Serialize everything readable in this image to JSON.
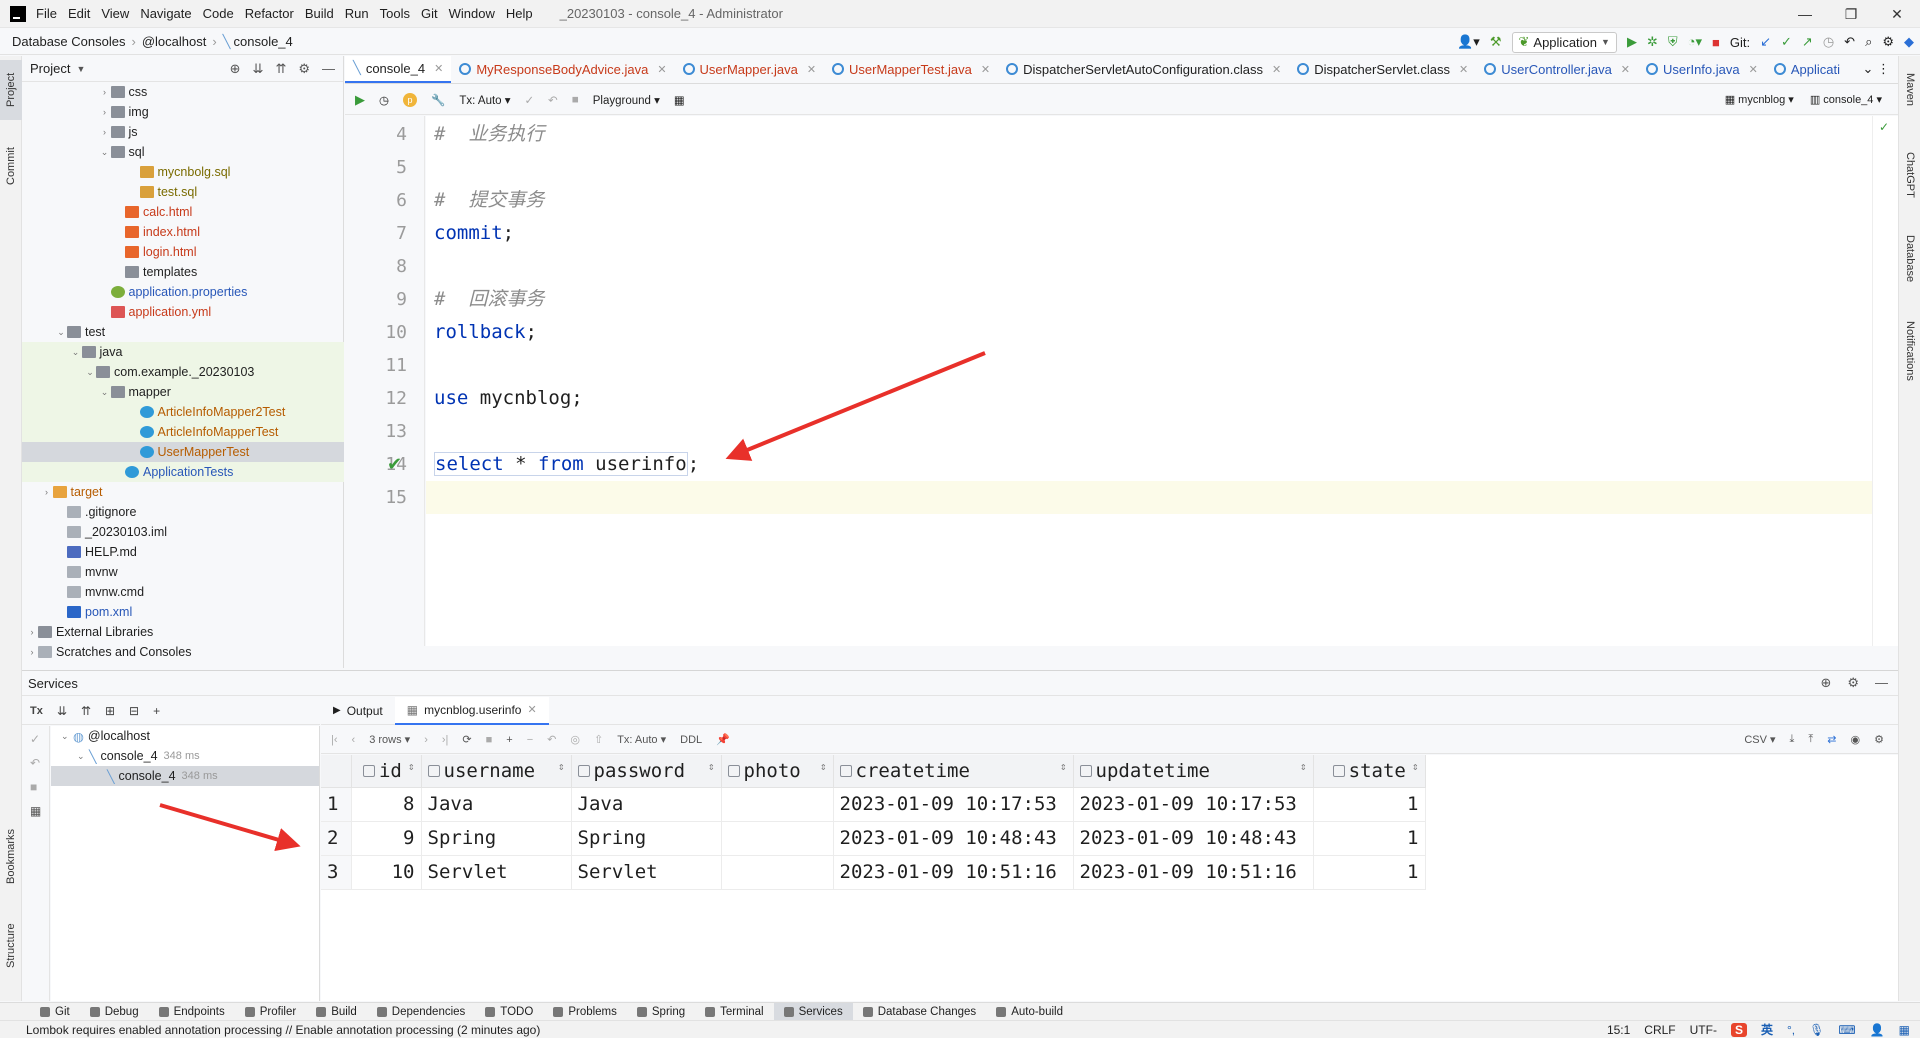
{
  "titlebar": {
    "menu": [
      "File",
      "Edit",
      "View",
      "Navigate",
      "Code",
      "Refactor",
      "Build",
      "Run",
      "Tools",
      "Git",
      "Window",
      "Help"
    ],
    "title": "_20230103 - console_4 - Administrator"
  },
  "navbar": {
    "crumbs": [
      "Database Consoles",
      "@localhost",
      "console_4"
    ],
    "run_config": "Application",
    "git_label": "Git:"
  },
  "left_stripe": {
    "project": "Project",
    "commit": "Commit",
    "bookmarks": "Bookmarks",
    "structure": "Structure"
  },
  "right_stripe": {
    "maven": "Maven",
    "chatgpt": "ChatGPT",
    "database": "Database",
    "notifications": "Notifications"
  },
  "project": {
    "title": "Project",
    "tree": [
      {
        "label": "css",
        "depth": 5,
        "icon": "folder",
        "arrow": "›"
      },
      {
        "label": "img",
        "depth": 5,
        "icon": "folder",
        "arrow": "›"
      },
      {
        "label": "js",
        "depth": 5,
        "icon": "folder",
        "arrow": "›"
      },
      {
        "label": "sql",
        "depth": 5,
        "icon": "folder",
        "arrow": "⌄"
      },
      {
        "label": "mycnbolg.sql",
        "depth": 7,
        "icon": "sql",
        "color": "olive"
      },
      {
        "label": "test.sql",
        "depth": 7,
        "icon": "sql",
        "color": "olive"
      },
      {
        "label": "calc.html",
        "depth": 6,
        "icon": "html",
        "color": "red"
      },
      {
        "label": "index.html",
        "depth": 6,
        "icon": "html",
        "color": "red"
      },
      {
        "label": "login.html",
        "depth": 6,
        "icon": "html",
        "color": "red"
      },
      {
        "label": "templates",
        "depth": 6,
        "icon": "folder"
      },
      {
        "label": "application.properties",
        "depth": 5,
        "icon": "prop",
        "color": "blue"
      },
      {
        "label": "application.yml",
        "depth": 5,
        "icon": "yml",
        "color": "red"
      },
      {
        "label": "test",
        "depth": 2,
        "icon": "folder",
        "arrow": "⌄"
      },
      {
        "label": "java",
        "depth": 3,
        "icon": "folder-green",
        "arrow": "⌄",
        "hl": "green"
      },
      {
        "label": "com.example._20230103",
        "depth": 4,
        "icon": "folder",
        "arrow": "⌄",
        "hl": "green"
      },
      {
        "label": "mapper",
        "depth": 5,
        "icon": "folder",
        "arrow": "⌄",
        "hl": "green"
      },
      {
        "label": "ArticleInfoMapper2Test",
        "depth": 7,
        "icon": "java",
        "color": "orange",
        "hl": "green"
      },
      {
        "label": "ArticleInfoMapperTest",
        "depth": 7,
        "icon": "java",
        "color": "orange",
        "hl": "green"
      },
      {
        "label": "UserMapperTest",
        "depth": 7,
        "icon": "java",
        "color": "orange",
        "hl": "sel"
      },
      {
        "label": "ApplicationTests",
        "depth": 6,
        "icon": "java",
        "color": "blue",
        "hl": "green"
      },
      {
        "label": "target",
        "depth": 1,
        "icon": "folder-orange",
        "arrow": "›",
        "color": "orange"
      },
      {
        "label": ".gitignore",
        "depth": 2,
        "icon": "gen"
      },
      {
        "label": "_20230103.iml",
        "depth": 2,
        "icon": "gen"
      },
      {
        "label": "HELP.md",
        "depth": 2,
        "icon": "md"
      },
      {
        "label": "mvnw",
        "depth": 2,
        "icon": "gen"
      },
      {
        "label": "mvnw.cmd",
        "depth": 2,
        "icon": "gen"
      },
      {
        "label": "pom.xml",
        "depth": 2,
        "icon": "xml",
        "color": "blue"
      },
      {
        "label": "External Libraries",
        "depth": 0,
        "icon": "lib",
        "arrow": "›"
      },
      {
        "label": "Scratches and Consoles",
        "depth": 0,
        "icon": "gen",
        "arrow": "›"
      }
    ]
  },
  "editor": {
    "tabs": [
      {
        "label": "console_4",
        "active": true,
        "color": "#1f1f1f"
      },
      {
        "label": "MyResponseBodyAdvice.java",
        "color": "#c73a1a"
      },
      {
        "label": "UserMapper.java",
        "color": "#c73a1a"
      },
      {
        "label": "UserMapperTest.java",
        "color": "#c73a1a"
      },
      {
        "label": "DispatcherServletAutoConfiguration.class",
        "color": "#1f1f1f"
      },
      {
        "label": "DispatcherServlet.class",
        "color": "#1f1f1f"
      },
      {
        "label": "UserController.java",
        "color": "#2857b8"
      },
      {
        "label": "UserInfo.java",
        "color": "#2857b8"
      },
      {
        "label": "Applicati",
        "color": "#2857b8"
      }
    ],
    "toolbar": {
      "tx": "Tx: Auto",
      "playground": "Playground",
      "schema": "mycnblog",
      "console": "console_4"
    },
    "lines": [
      {
        "n": "4",
        "html": "<span class='cmt'>#  业务执行</span>"
      },
      {
        "n": "5",
        "html": ""
      },
      {
        "n": "6",
        "html": "<span class='cmt'>#  提交事务</span>"
      },
      {
        "n": "7",
        "html": "<span class='kw'>commit</span>;"
      },
      {
        "n": "8",
        "html": ""
      },
      {
        "n": "9",
        "html": "<span class='cmt'>#  回滚事务</span>"
      },
      {
        "n": "10",
        "html": "<span class='kw'>rollback</span>;"
      },
      {
        "n": "11",
        "html": ""
      },
      {
        "n": "12",
        "html": "<span class='kw'>use</span> mycnblog;"
      },
      {
        "n": "13",
        "html": ""
      },
      {
        "n": "14",
        "html": "<span style='border:1px solid #c8d4ea'><span class='kw'>select</span> * <span class='kw'>from</span> userinfo</span>;"
      },
      {
        "n": "15",
        "html": ""
      }
    ]
  },
  "services": {
    "title": "Services",
    "tree": [
      {
        "label": "@localhost",
        "ms": "",
        "indent": 10
      },
      {
        "label": "console_4",
        "ms": "348 ms",
        "indent": 26
      },
      {
        "label": "console_4",
        "ms": "348 ms",
        "indent": 44,
        "sel": true
      }
    ],
    "tabs": [
      "Output",
      "mycnblog.userinfo"
    ],
    "toolbar": {
      "rows": "3 rows",
      "tx": "Tx: Auto",
      "ddl": "DDL",
      "csv": "CSV"
    },
    "columns": [
      "id",
      "username",
      "password",
      "photo",
      "createtime",
      "updatetime",
      "state"
    ],
    "rows": [
      [
        "1",
        "8",
        "Java",
        "Java",
        "",
        "2023-01-09 10:17:53",
        "2023-01-09 10:17:53",
        "1"
      ],
      [
        "2",
        "9",
        "Spring",
        "Spring",
        "",
        "2023-01-09 10:48:43",
        "2023-01-09 10:48:43",
        "1"
      ],
      [
        "3",
        "10",
        "Servlet",
        "Servlet",
        "",
        "2023-01-09 10:51:16",
        "2023-01-09 10:51:16",
        "1"
      ]
    ]
  },
  "bottom_tools": [
    "Git",
    "Debug",
    "Endpoints",
    "Profiler",
    "Build",
    "Dependencies",
    "TODO",
    "Problems",
    "Spring",
    "Terminal",
    "Services",
    "Database Changes",
    "Auto-build"
  ],
  "status": {
    "message": "Lombok requires enabled annotation processing // Enable annotation processing (2 minutes ago)",
    "position": "15:1",
    "eol": "CRLF",
    "encoding": "UTF-",
    "ime": "英"
  },
  "colors": {
    "accent": "#3574f0",
    "keyword": "#0033b3",
    "arrow": "#e8302a"
  }
}
